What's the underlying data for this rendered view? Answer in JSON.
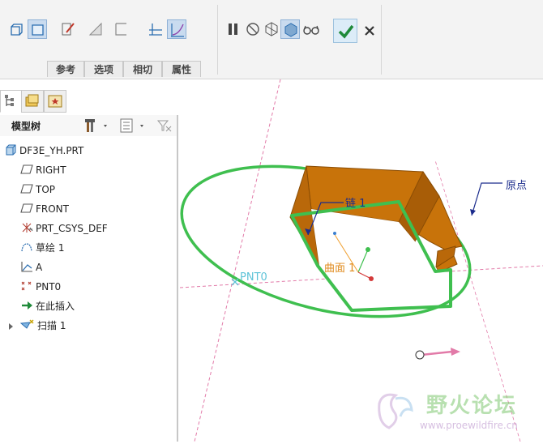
{
  "ribbon": {
    "tabs": [
      "参考",
      "选项",
      "相切",
      "属性"
    ]
  },
  "model_tree": {
    "title": "模型树",
    "items": [
      {
        "label": "DF3E_YH.PRT",
        "icon": "part-icon"
      },
      {
        "label": "RIGHT",
        "icon": "datum-plane-icon"
      },
      {
        "label": "TOP",
        "icon": "datum-plane-icon"
      },
      {
        "label": "FRONT",
        "icon": "datum-plane-icon"
      },
      {
        "label": "PRT_CSYS_DEF",
        "icon": "csys-icon"
      },
      {
        "label": "草绘 1",
        "icon": "sketch-icon"
      },
      {
        "label": "A",
        "icon": "datum-axis-icon"
      },
      {
        "label": "PNT0",
        "icon": "datum-point-icon"
      },
      {
        "label": "在此插入",
        "icon": "insert-here-arrow-icon"
      },
      {
        "label": "扫描 1",
        "icon": "sweep-icon"
      }
    ]
  },
  "viewport": {
    "label_origin": "原点",
    "label_chain": "链 1",
    "label_surface": "曲面 1",
    "label_point": "PNT0"
  },
  "watermark": {
    "brand": "野火论坛",
    "url": "www.proewildfire.cn"
  },
  "colors": {
    "solid": "#c8730a",
    "trajectory": "#3fbf4f",
    "datum": "#e27aa8",
    "accent": "#2a6db0"
  }
}
